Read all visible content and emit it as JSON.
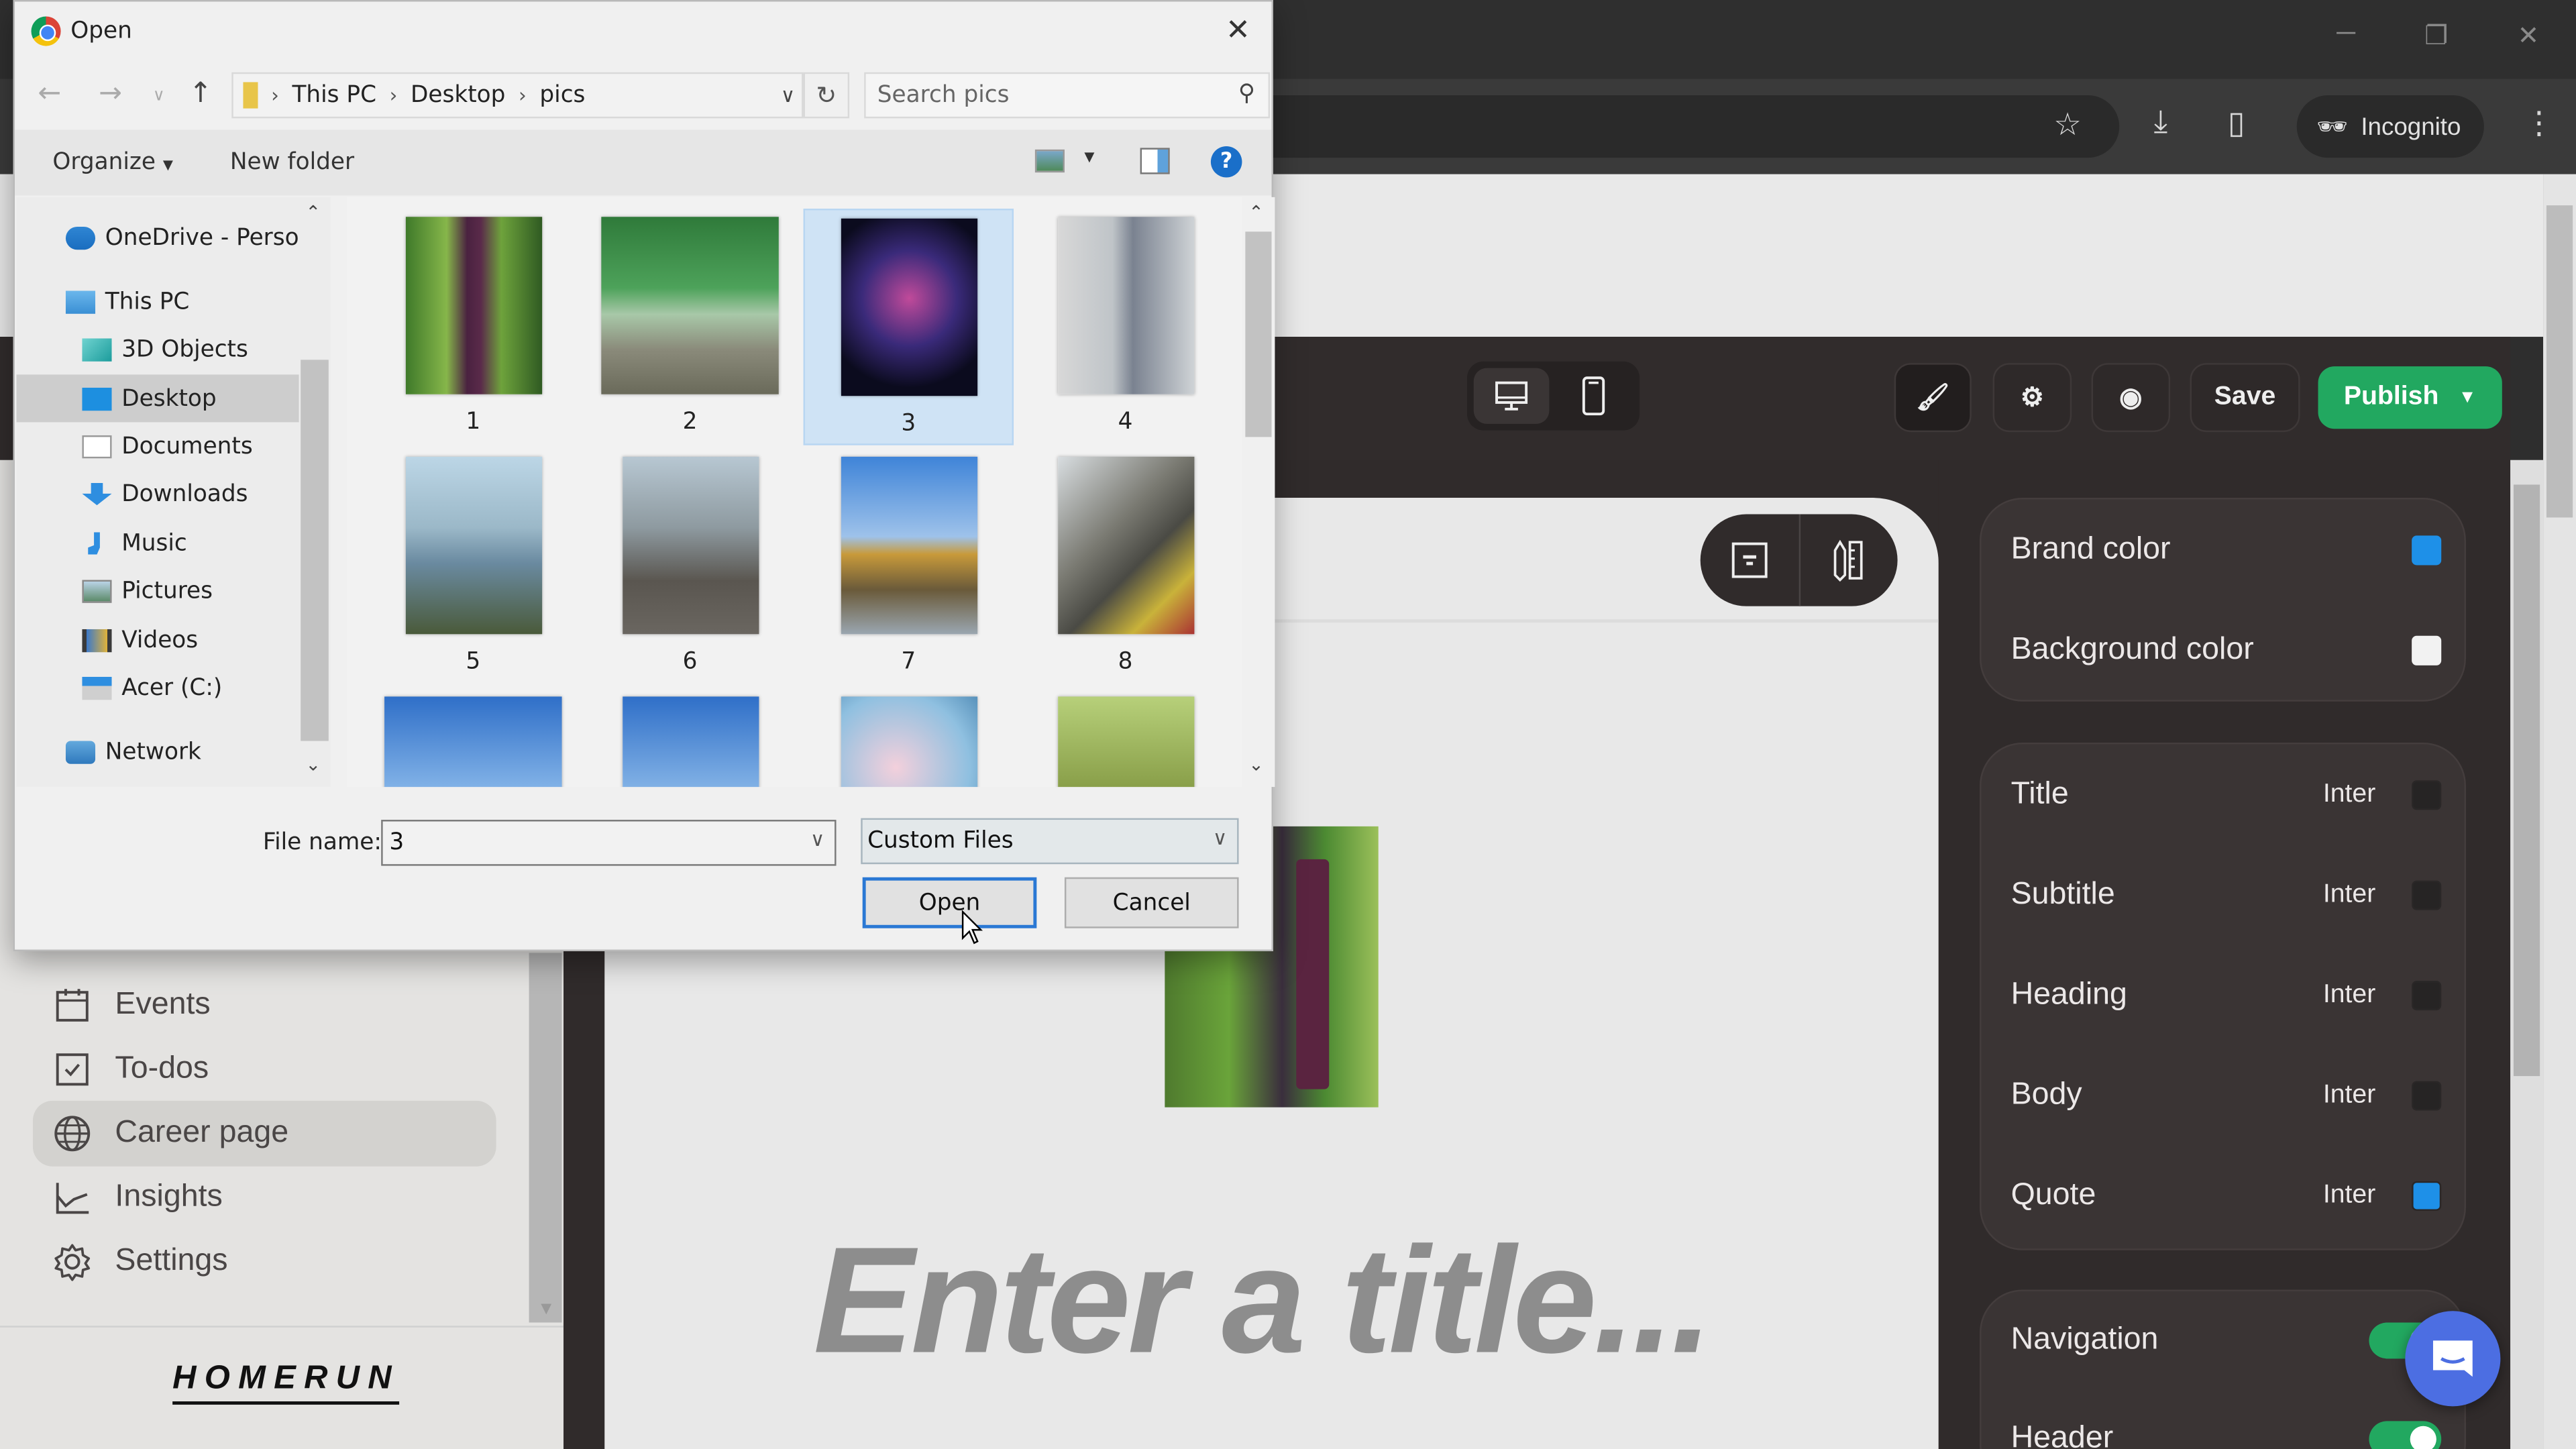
{
  "browser": {
    "incognito_label": "Incognito"
  },
  "app": {
    "header": {
      "save_label": "Save",
      "publish_label": "Publish"
    },
    "sidebar": {
      "items": [
        {
          "label": "Events",
          "icon": "calendar-icon"
        },
        {
          "label": "To-dos",
          "icon": "checkbox-icon"
        },
        {
          "label": "Career page",
          "icon": "globe-icon",
          "active": true
        },
        {
          "label": "Insights",
          "icon": "chart-line-icon"
        },
        {
          "label": "Settings",
          "icon": "gear-icon"
        }
      ],
      "logo": "HOMERUN"
    },
    "canvas": {
      "title_placeholder": "Enter a title..."
    },
    "panel": {
      "colors": [
        {
          "label": "Brand color",
          "color": "#1e90e8"
        },
        {
          "label": "Background color",
          "color": "#f2f2f2"
        }
      ],
      "typography": [
        {
          "label": "Title",
          "font": "Inter",
          "color": "#262424"
        },
        {
          "label": "Subtitle",
          "font": "Inter",
          "color": "#262424"
        },
        {
          "label": "Heading",
          "font": "Inter",
          "color": "#262424"
        },
        {
          "label": "Body",
          "font": "Inter",
          "color": "#262424"
        },
        {
          "label": "Quote",
          "font": "Inter",
          "color": "#1e90e8"
        }
      ],
      "toggles": [
        {
          "label": "Navigation",
          "on": true
        },
        {
          "label": "Header",
          "on": true
        }
      ]
    }
  },
  "dialog": {
    "title": "Open",
    "breadcrumb": [
      "This PC",
      "Desktop",
      "pics"
    ],
    "search_placeholder": "Search pics",
    "organize_label": "Organize",
    "new_folder_label": "New folder",
    "tree": [
      {
        "label": "OneDrive - Person",
        "level": 0
      },
      {
        "label": "This PC",
        "level": 0
      },
      {
        "label": "3D Objects",
        "level": 1
      },
      {
        "label": "Desktop",
        "level": 1,
        "selected": true
      },
      {
        "label": "Documents",
        "level": 1
      },
      {
        "label": "Downloads",
        "level": 1
      },
      {
        "label": "Music",
        "level": 1
      },
      {
        "label": "Pictures",
        "level": 1
      },
      {
        "label": "Videos",
        "level": 1
      },
      {
        "label": "Acer (C:)",
        "level": 1
      },
      {
        "label": "Network",
        "level": 0
      }
    ],
    "files": [
      "1",
      "2",
      "3",
      "4",
      "5",
      "6",
      "7",
      "8",
      "",
      "",
      "",
      ""
    ],
    "selected_file": "3",
    "file_name_label": "File name:",
    "file_name_value": "3",
    "file_type": "Custom Files",
    "open_label": "Open",
    "cancel_label": "Cancel"
  }
}
